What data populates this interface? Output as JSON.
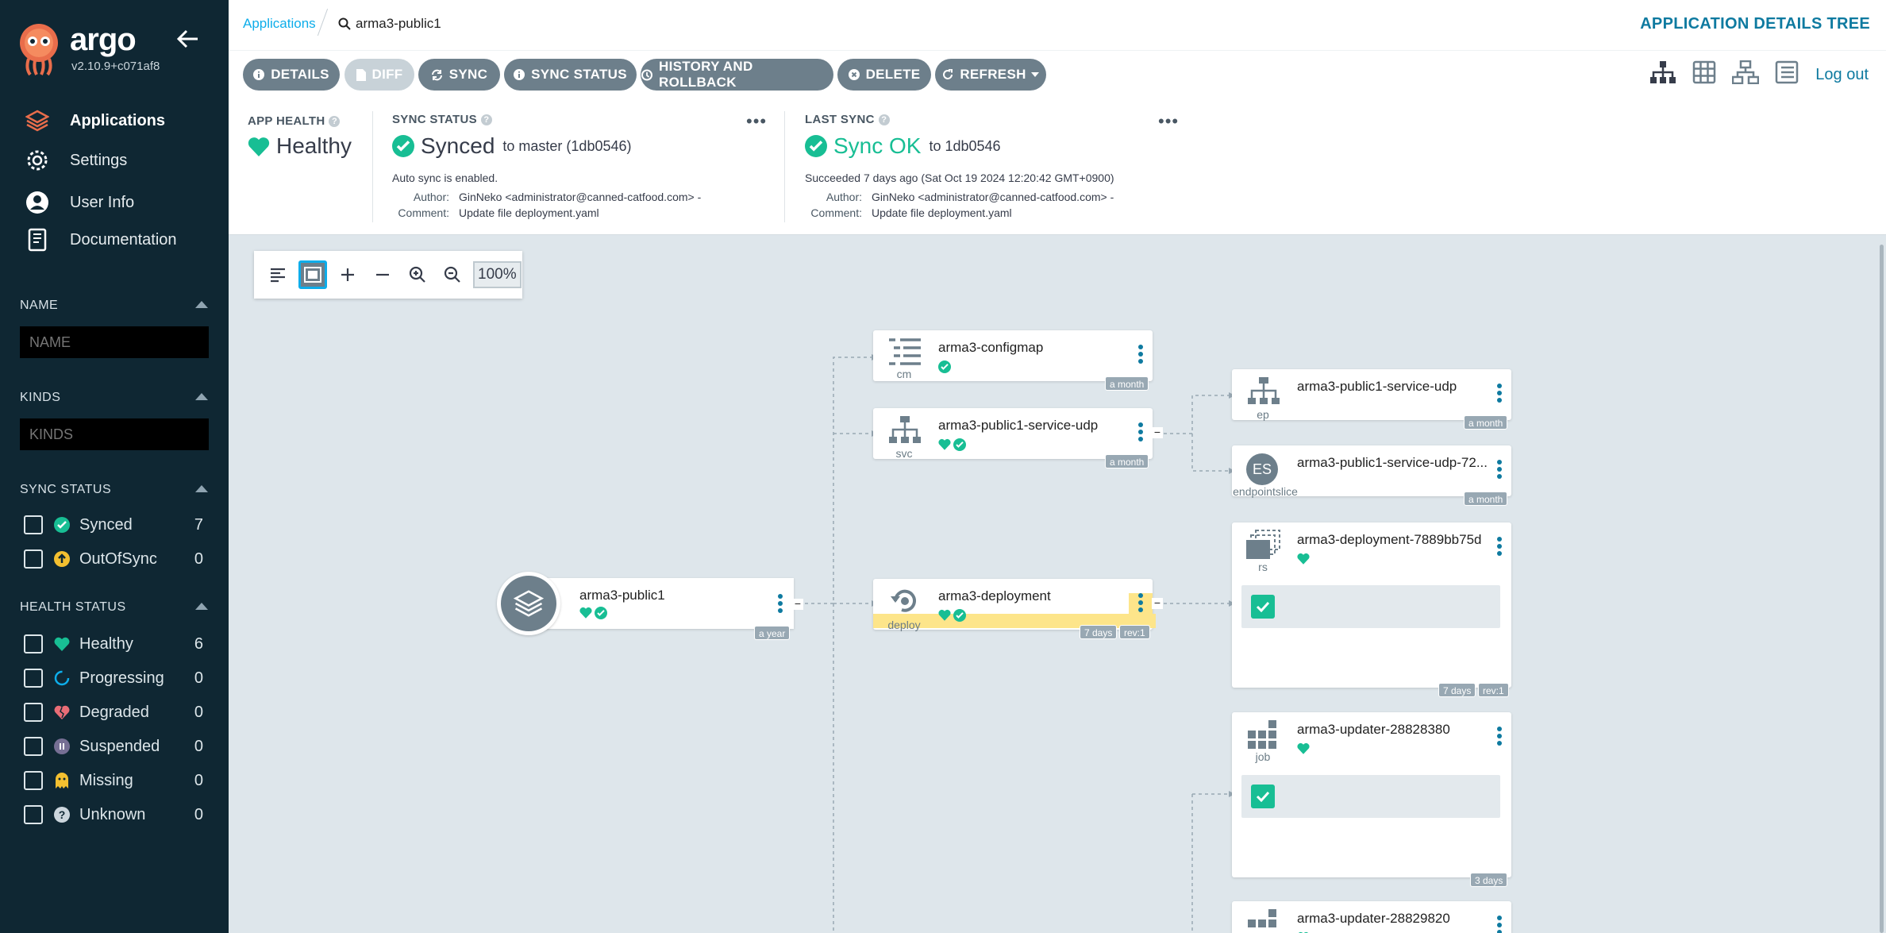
{
  "sidebar": {
    "logo_text": "argo",
    "version": "v2.10.9+c071af8",
    "nav": [
      {
        "label": "Applications",
        "icon": "layers-icon"
      },
      {
        "label": "Settings",
        "icon": "gear-icon"
      },
      {
        "label": "User Info",
        "icon": "user-icon"
      },
      {
        "label": "Documentation",
        "icon": "book-icon"
      }
    ],
    "name_filter": {
      "title": "NAME",
      "placeholder": "NAME"
    },
    "kinds_filter": {
      "title": "KINDS",
      "placeholder": "KINDS"
    },
    "sync_status": {
      "title": "SYNC STATUS",
      "items": [
        {
          "label": "Synced",
          "count": "7",
          "color": "#18be94"
        },
        {
          "label": "OutOfSync",
          "count": "0",
          "color": "#f4c030"
        }
      ]
    },
    "health_status": {
      "title": "HEALTH STATUS",
      "items": [
        {
          "label": "Healthy",
          "count": "6",
          "color": "#18be94"
        },
        {
          "label": "Progressing",
          "count": "0",
          "color": "#0dadea"
        },
        {
          "label": "Degraded",
          "count": "0",
          "color": "#e96d76"
        },
        {
          "label": "Suspended",
          "count": "0",
          "color": "#766f94"
        },
        {
          "label": "Missing",
          "count": "0",
          "color": "#f4c030"
        },
        {
          "label": "Unknown",
          "count": "0",
          "color": "#ccd6dd"
        }
      ]
    }
  },
  "topbar": {
    "breadcrumb_app": "Applications",
    "breadcrumb_current": "arma3-public1",
    "title": "APPLICATION DETAILS TREE"
  },
  "toolbar": {
    "buttons": [
      {
        "label": "DETAILS",
        "icon": "info-icon",
        "disabled": false
      },
      {
        "label": "DIFF",
        "icon": "file-icon",
        "disabled": true
      },
      {
        "label": "SYNC",
        "icon": "sync-icon",
        "disabled": false
      },
      {
        "label": "SYNC STATUS",
        "icon": "info-icon",
        "disabled": false
      },
      {
        "label": "HISTORY AND ROLLBACK",
        "icon": "history-icon",
        "disabled": false
      },
      {
        "label": "DELETE",
        "icon": "times-circle-icon",
        "disabled": false
      },
      {
        "label": "REFRESH",
        "icon": "redo-icon",
        "disabled": false
      }
    ],
    "logout": "Log out"
  },
  "status": {
    "app_health": {
      "label": "APP HEALTH",
      "value": "Healthy"
    },
    "sync_status": {
      "label": "SYNC STATUS",
      "value": "Synced",
      "target": "to master (1db0546)",
      "auto": "Auto sync is enabled.",
      "author_key": "Author:",
      "author": "GinNeko <administrator@canned-catfood.com> -",
      "comment_key": "Comment:",
      "comment": "Update file deployment.yaml"
    },
    "last_sync": {
      "label": "LAST SYNC",
      "value": "Sync OK",
      "target": "to 1db0546",
      "succeeded": "Succeeded 7 days ago (Sat Oct 19 2024 12:20:42 GMT+0900)",
      "author_key": "Author:",
      "author": "GinNeko <administrator@canned-catfood.com> -",
      "comment_key": "Comment:",
      "comment": "Update file deployment.yaml"
    }
  },
  "graph": {
    "zoom": "100%",
    "nodes": {
      "app": {
        "name": "arma3-public1",
        "age": "a year"
      },
      "configmap": {
        "name": "arma3-configmap",
        "kind": "cm",
        "age": "a month"
      },
      "service": {
        "name": "arma3-public1-service-udp",
        "kind": "svc",
        "age": "a month"
      },
      "endpoint": {
        "name": "arma3-public1-service-udp",
        "kind": "ep",
        "age": "a month"
      },
      "endpointslice": {
        "name": "arma3-public1-service-udp-72...",
        "kind": "endpointslice",
        "badge": "ES",
        "age": "a month"
      },
      "deployment": {
        "name": "arma3-deployment",
        "kind": "deploy",
        "age": "7 days",
        "rev": "rev:1"
      },
      "replicaset": {
        "name": "arma3-deployment-7889bb75d",
        "kind": "rs",
        "age": "7 days",
        "rev": "rev:1"
      },
      "job1": {
        "name": "arma3-updater-28828380",
        "kind": "job",
        "age": "3 days"
      },
      "job2": {
        "name": "arma3-updater-28829820"
      }
    }
  },
  "colors": {
    "accent": "#0dadea",
    "healthy": "#18be94",
    "sidebar_bg": "#0f2733",
    "button": "#6d7f8b"
  }
}
